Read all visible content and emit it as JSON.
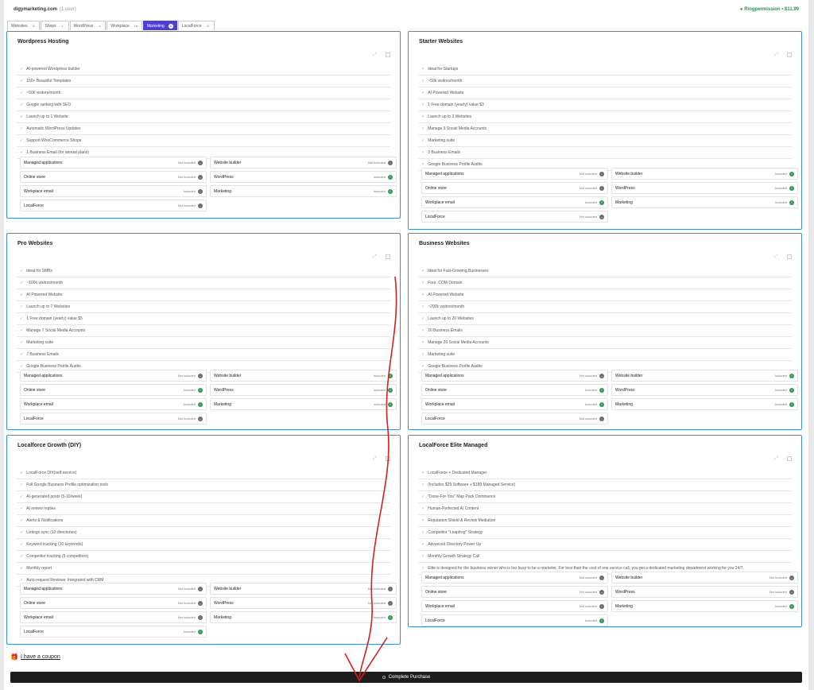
{
  "header": {
    "site": "digymarketing.com",
    "site_sub": "(1 user)",
    "balance": "● Ringpermission • $11.99"
  },
  "tabs": [
    {
      "label": "Websites",
      "count": "6",
      "active": false
    },
    {
      "label": "Shops",
      "count": "1",
      "active": false
    },
    {
      "label": "WordPress",
      "count": "4",
      "active": false
    },
    {
      "label": "Workplace",
      "count": "16",
      "active": false
    },
    {
      "label": "Marketing",
      "count": "6",
      "active": true
    },
    {
      "label": "LocalForce",
      "count": "6",
      "active": false
    }
  ],
  "status_labels": {
    "included": "Included",
    "not_included": "Not included"
  },
  "plans": [
    {
      "title": "Wordpress Hosting",
      "features": [
        "AI-powered Wordpress builder",
        "150+ Beautiful Templates",
        "~50k visitors/month",
        "Google ranking with SEO",
        "Launch up to 1 Website",
        "Automatic WordPress Updates",
        "Support WooCommerce Shops",
        "1 Business Email (for annual plans)"
      ],
      "services": [
        {
          "name": "Managed applications",
          "status": "Not included",
          "included": false
        },
        {
          "name": "Website builder",
          "status": "Not included",
          "included": false
        },
        {
          "name": "Online store",
          "status": "Not included",
          "included": false
        },
        {
          "name": "WordPress",
          "status": "Included",
          "included": true
        },
        {
          "name": "Workplace email",
          "status": "Included",
          "included": false
        },
        {
          "name": "Marketing",
          "status": "Included",
          "included": true
        },
        {
          "name": "LocalForce",
          "status": "Not included",
          "included": false
        }
      ]
    },
    {
      "title": "Starter Websites",
      "features": [
        "Ideal for Startups",
        "~50k visitors/month",
        "AI Powered Website",
        "1 Free domain (yearly) value $3",
        "Launch up to 3 Websites",
        "Manage 3 Social Media Accounts",
        "Marketing suite",
        "3 Business Emails",
        "Google Business Profile Audits"
      ],
      "services": [
        {
          "name": "Managed applications",
          "status": "Not included",
          "included": false
        },
        {
          "name": "Website builder",
          "status": "Included",
          "included": true
        },
        {
          "name": "Online store",
          "status": "Not included",
          "included": false
        },
        {
          "name": "WordPress",
          "status": "Included",
          "included": true
        },
        {
          "name": "Workplace email",
          "status": "Included",
          "included": true
        },
        {
          "name": "Marketing",
          "status": "Included",
          "included": true
        },
        {
          "name": "LocalForce",
          "status": "Not included",
          "included": false
        }
      ]
    },
    {
      "title": "Pro Websites",
      "features": [
        "Ideal for SMBs",
        "~100k visitors/month",
        "AI Powered Website",
        "Launch up to 7 Websites",
        "1 Free domain (yearly) value $5",
        "Manage 7 Social Media Accounts",
        "Marketing suite",
        "7 Business Emails",
        "Google Business Profile Audits"
      ],
      "services": [
        {
          "name": "Managed applications",
          "status": "Not included",
          "included": false
        },
        {
          "name": "Website builder",
          "status": "Included",
          "included": true
        },
        {
          "name": "Online store",
          "status": "Included",
          "included": true
        },
        {
          "name": "WordPress",
          "status": "Included",
          "included": true
        },
        {
          "name": "Workplace email",
          "status": "Included",
          "included": true
        },
        {
          "name": "Marketing",
          "status": "Included",
          "included": true
        },
        {
          "name": "LocalForce",
          "status": "Not included",
          "included": false
        }
      ]
    },
    {
      "title": "Business Websites",
      "features": [
        "Ideal for Fast-Growing Businesses",
        "Free .COM Domain",
        "AI Powered Website",
        "~200k visitors/month",
        "Launch up to 20 Websites",
        "20 Business Emails",
        "Manage 20 Social Media Accounts",
        "Marketing suite",
        "Google Business Profile Audits"
      ],
      "services": [
        {
          "name": "Managed applications",
          "status": "Not included",
          "included": false
        },
        {
          "name": "Website builder",
          "status": "Included",
          "included": true
        },
        {
          "name": "Online store",
          "status": "Included",
          "included": true
        },
        {
          "name": "WordPress",
          "status": "Included",
          "included": true
        },
        {
          "name": "Workplace email",
          "status": "Included",
          "included": true
        },
        {
          "name": "Marketing",
          "status": "Included",
          "included": true
        },
        {
          "name": "LocalForce",
          "status": "Not included",
          "included": false
        }
      ]
    },
    {
      "title": "Localforce Growth (DIY)",
      "features": [
        "LocalForce DIY(self-service)",
        "Full Google Business Profile optimization tools",
        "AI-generated posts (5-10/week)",
        "AI review replies",
        "Alerts & Notifications",
        "Listings sync (10 directories)",
        "Keyword tracking (10 keywords)",
        "Competitor tracking (5 competitors)",
        "Monthly report",
        "Auto-request Reviews: Integrated with CRM"
      ],
      "services": [
        {
          "name": "Managed applications",
          "status": "Not included",
          "included": false
        },
        {
          "name": "Website builder",
          "status": "Not included",
          "included": false
        },
        {
          "name": "Online store",
          "status": "Not included",
          "included": false
        },
        {
          "name": "WordPress",
          "status": "Not included",
          "included": false
        },
        {
          "name": "Workplace email",
          "status": "Not included",
          "included": false
        },
        {
          "name": "Marketing",
          "status": "Included",
          "included": true
        },
        {
          "name": "LocalForce",
          "status": "Included",
          "included": true
        }
      ]
    },
    {
      "title": "LocalForce Elite Managed",
      "features": [
        "LocalForce + Dedicated Manager",
        "(Includes $29 Software + $189 Managed Service)",
        "\"Done-For-You\" Map Pack Dominance",
        "Human-Perfected AI Content",
        "Reputation Shield & Review Mediation",
        "Competitor \"Leapfrog\" Strategy",
        "Advanced Directory Power Up",
        "Monthly Growth Strategy Call",
        "Elite is designed for the business owner who is too busy to be a marketer. For less than the cost of one service call, you get a dedicated marketing department working for you 24/7."
      ],
      "services": [
        {
          "name": "Managed applications",
          "status": "Not included",
          "included": false
        },
        {
          "name": "Website builder",
          "status": "Not included",
          "included": false
        },
        {
          "name": "Online store",
          "status": "Not included",
          "included": false
        },
        {
          "name": "WordPress",
          "status": "Not included",
          "included": false
        },
        {
          "name": "Workplace email",
          "status": "Not included",
          "included": false
        },
        {
          "name": "Marketing",
          "status": "Included",
          "included": true
        },
        {
          "name": "LocalForce",
          "status": "Included",
          "included": true
        }
      ]
    }
  ],
  "footer": {
    "coupon": "I have a coupon",
    "purchase": "Complete Purchase"
  },
  "colors": {
    "accent": "#4f3fd6",
    "card_border": "#3b8fd9",
    "included": "#2f9a55",
    "not_included": "#6b6b6b",
    "annotation": "#d42020"
  }
}
